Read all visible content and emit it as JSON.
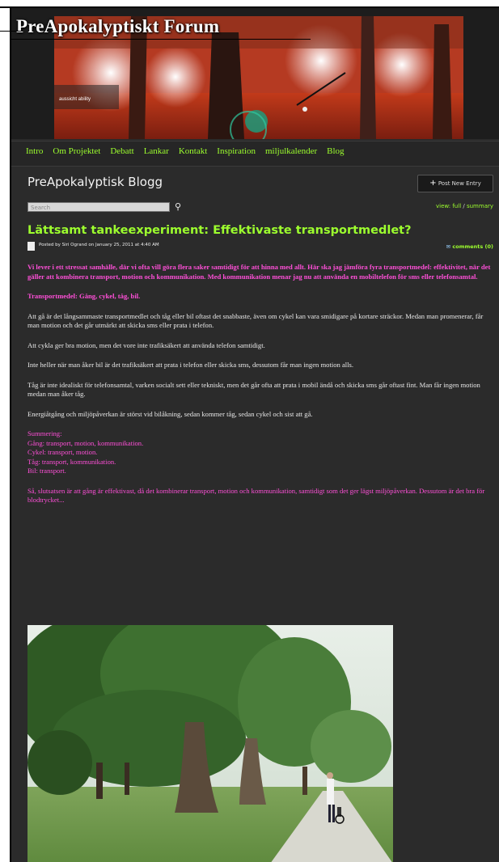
{
  "site": {
    "title": "PreApokalyptiskt Forum",
    "banner_caption": "aussicht ability"
  },
  "nav": {
    "items": [
      "Intro",
      "Om Projektet",
      "Debatt",
      "Lankar",
      "Kontakt",
      "Inspiration",
      "miljulkalender",
      "Blog"
    ]
  },
  "blog": {
    "title": "PreApokalyptisk Blogg",
    "post_button": "Post New Entry"
  },
  "search": {
    "placeholder": "Search",
    "view_label": "view:",
    "view_full": "full",
    "view_separator": "/",
    "view_summary": "summary"
  },
  "post": {
    "title": "Lättsamt tankeexperiment: Effektivaste transportmedlet?",
    "meta": "Posted by Siri Ogrand on January 25, 2011 at 4:40 AM",
    "comments": "comments (0)",
    "intro": "Vi lever i ett stressat samhälle, där vi ofta vill göra flera saker samtidigt för att hinna med allt. Här ska jag jämföra fyra transportmedel: effektivitet, när det gäller att kombinera transport, motion och kommunikation. Med kommunikation menar jag nu att använda en mobiltelefon för sms eller telefonsamtal.",
    "subheading": "Transportmedel: Gång, cykel, tåg, bil.",
    "paragraphs": [
      "Att gå är det långsammaste transportmedlet och tåg eller bil oftast det snabbaste, även om cykel kan vara smidigare på kortare sträckor. Medan man promenerar, får man motion och det går utmärkt att skicka sms eller prata i telefon.",
      "Att cykla ger bra motion, men det vore inte trafiksäkert att använda telefon samtidigt.",
      "Inte heller när man åker bil är det trafiksäkert att prata i telefon eller skicka sms, dessutom får man ingen motion alls.",
      "Tåg är inte idealiskt för telefonsamtal, varken socialt sett eller tekniskt, men det går ofta att prata i mobil ändå och skicka sms går oftast fint. Man får ingen motion medan man åker tåg.",
      "Energiåtgång och miljöpåverkan är störst vid bilåkning, sedan kommer tåg, sedan cykel och sist att gå."
    ],
    "summary": {
      "heading": "Summering:",
      "lines": [
        "Gång: transport, motion, kommunikation.",
        "Cykel: transport, motion.",
        "Tåg: transport, kommunikation.",
        "Bil: transport."
      ]
    },
    "conclusion": "Så, slutsatsen är att gång är effektivast, då det kombinerar transport, motion och kommunikation, samtidigt som det ger lägst miljöpåverkan. Dessutom är det bra för blodtrycket..."
  },
  "colors": {
    "accent_green": "#9dff2e",
    "accent_pink": "#ff4fd8",
    "background": "#2b2b2b"
  }
}
